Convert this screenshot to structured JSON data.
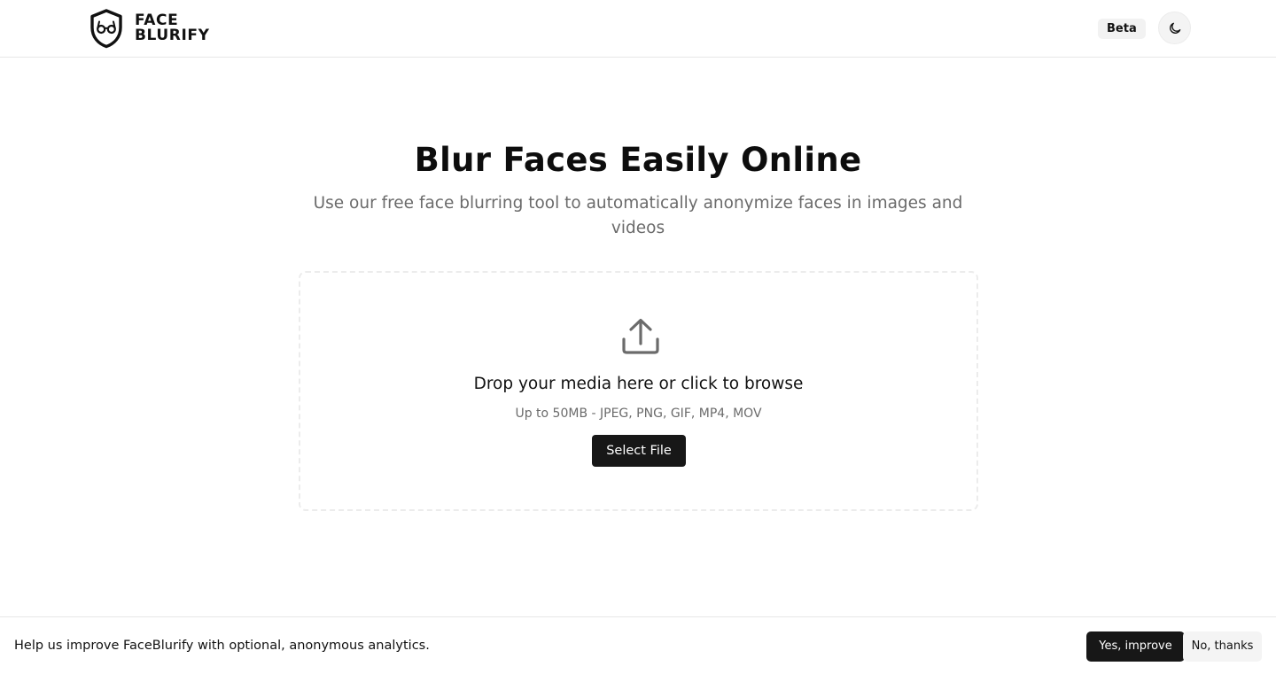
{
  "header": {
    "logo": {
      "icon": "shield-glasses-icon",
      "line1": "FACE",
      "line2": "BLURIFY"
    },
    "badge": "Beta",
    "theme_toggle_icon": "moon-icon"
  },
  "hero": {
    "title": "Blur Faces Easily Online",
    "subtitle": "Use our free face blurring tool to automatically anonymize faces in images and videos"
  },
  "dropzone": {
    "icon": "upload-icon",
    "title": "Drop your media here or click to browse",
    "hint": "Up to 50MB - JPEG, PNG, GIF, MP4, MOV",
    "button_label": "Select File"
  },
  "consent": {
    "message": "Help us improve FaceBlurify with optional, anonymous analytics.",
    "accept_label": "Yes, improve",
    "decline_label": "No, thanks"
  },
  "colors": {
    "primary_button": "#171717",
    "muted_text": "#6b6b6b",
    "border": "#e6e6e6"
  }
}
